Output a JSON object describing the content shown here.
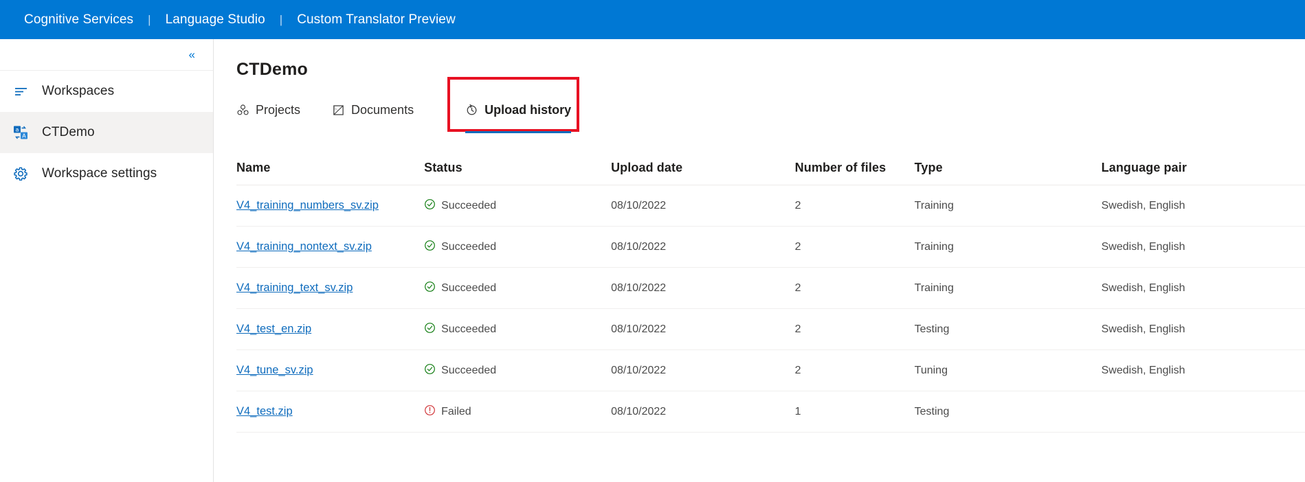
{
  "topbar": {
    "links": [
      "Cognitive Services",
      "Language Studio",
      "Custom Translator Preview"
    ],
    "separator": "|",
    "background": "#0078d4"
  },
  "sidebar": {
    "collapse_icon": "chevron-double-left-icon",
    "collapse_glyph": "«",
    "items": [
      {
        "label": "Workspaces",
        "icon": "list-icon",
        "selected": false
      },
      {
        "label": "CTDemo",
        "icon": "translate-icon",
        "selected": true
      },
      {
        "label": "Workspace settings",
        "icon": "gear-icon",
        "selected": false
      }
    ]
  },
  "main": {
    "page_title": "CTDemo",
    "tabs": [
      {
        "label": "Projects",
        "icon": "projects-icon",
        "active": false
      },
      {
        "label": "Documents",
        "icon": "documents-icon",
        "active": false
      },
      {
        "label": "Upload history",
        "icon": "history-clock-icon",
        "active": true
      }
    ],
    "highlight_color": "#e81123",
    "accent_color": "#0f6cbd"
  },
  "table": {
    "columns": [
      "Name",
      "Status",
      "Upload date",
      "Number of files",
      "Type",
      "Language pair"
    ],
    "status_colors": {
      "succeeded": "#107c10",
      "failed": "#d13438"
    },
    "rows": [
      {
        "name": "V4_training_numbers_sv.zip",
        "status": "Succeeded",
        "status_kind": "succeeded",
        "upload_date": "08/10/2022",
        "number_of_files": "2",
        "type": "Training",
        "language_pair": "Swedish, English"
      },
      {
        "name": "V4_training_nontext_sv.zip",
        "status": "Succeeded",
        "status_kind": "succeeded",
        "upload_date": "08/10/2022",
        "number_of_files": "2",
        "type": "Training",
        "language_pair": "Swedish, English"
      },
      {
        "name": "V4_training_text_sv.zip",
        "status": "Succeeded",
        "status_kind": "succeeded",
        "upload_date": "08/10/2022",
        "number_of_files": "2",
        "type": "Training",
        "language_pair": "Swedish, English"
      },
      {
        "name": "V4_test_en.zip",
        "status": "Succeeded",
        "status_kind": "succeeded",
        "upload_date": "08/10/2022",
        "number_of_files": "2",
        "type": "Testing",
        "language_pair": "Swedish, English"
      },
      {
        "name": "V4_tune_sv.zip",
        "status": "Succeeded",
        "status_kind": "succeeded",
        "upload_date": "08/10/2022",
        "number_of_files": "2",
        "type": "Tuning",
        "language_pair": "Swedish, English"
      },
      {
        "name": "V4_test.zip",
        "status": "Failed",
        "status_kind": "failed",
        "upload_date": "08/10/2022",
        "number_of_files": "1",
        "type": "Testing",
        "language_pair": ""
      }
    ]
  }
}
